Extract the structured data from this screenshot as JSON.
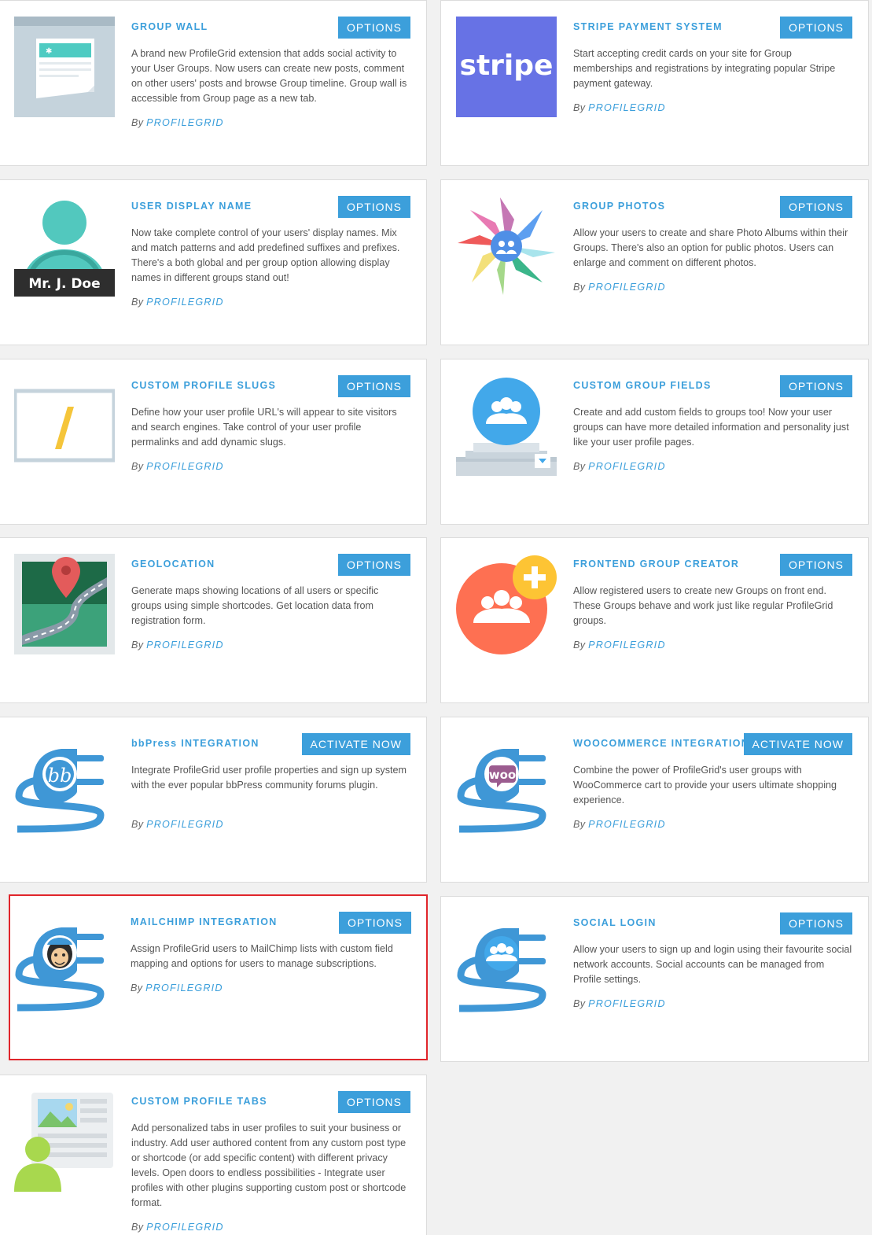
{
  "by_prefix": "By",
  "author": "PROFILEGRID",
  "colors": {
    "accent": "#3c9fdb",
    "highlight_border": "#e0252b"
  },
  "extensions": [
    {
      "title": "GROUP WALL",
      "button": "OPTIONS",
      "icon": "group-wall-icon",
      "desc": "A brand new ProfileGrid extension that adds social activity to your User Groups. Now users can create new posts, comment on other users' posts and browse Group timeline. Group wall is accessible from Group page as a new tab."
    },
    {
      "title": "STRIPE PAYMENT SYSTEM",
      "button": "OPTIONS",
      "icon": "stripe-logo-icon",
      "logo_text": "stripe",
      "desc": "Start accepting credit cards on your site for Group memberships and registrations by integrating popular Stripe payment gateway."
    },
    {
      "title": "USER DISPLAY NAME",
      "button": "OPTIONS",
      "icon": "user-display-name-icon",
      "logo_text": "Mr. J. Doe",
      "desc": "Now take complete control of your users' display names. Mix and match patterns and add predefined suffixes and prefixes. There's a both global and per group option allowing display names in different groups stand out!"
    },
    {
      "title": "GROUP PHOTOS",
      "button": "OPTIONS",
      "icon": "group-photos-icon",
      "desc": "Allow your users to create and share Photo Albums within their Groups. There's also an option for public photos. Users can enlarge and comment on different photos."
    },
    {
      "title": "CUSTOM PROFILE SLUGS",
      "button": "OPTIONS",
      "icon": "profile-slugs-icon",
      "desc": "Define how your user profile URL's will appear to site visitors and search engines. Take control of your user profile permalinks and add dynamic slugs."
    },
    {
      "title": "CUSTOM GROUP FIELDS",
      "button": "OPTIONS",
      "icon": "group-fields-icon",
      "desc": "Create and add custom fields to groups too! Now your user groups can have more detailed information and personality just like your user profile pages."
    },
    {
      "title": "GEOLOCATION",
      "button": "OPTIONS",
      "icon": "geolocation-map-icon",
      "desc": "Generate maps showing locations of all users or specific groups using simple shortcodes. Get location data from registration form."
    },
    {
      "title": "FRONTEND GROUP CREATOR",
      "button": "OPTIONS",
      "icon": "group-creator-icon",
      "desc": "Allow registered users to create new Groups on front end. These Groups behave and work just like regular ProfileGrid groups."
    },
    {
      "title": "bbPress INTEGRATION",
      "button": "ACTIVATE NOW",
      "icon": "bbpress-plug-icon",
      "desc": "Integrate ProfileGrid user profile properties and sign up system with the ever popular bbPress community forums plugin."
    },
    {
      "title": "WOOCOMMERCE INTEGRATION",
      "button": "ACTIVATE NOW",
      "icon": "woocommerce-plug-icon",
      "logo_text": "woo",
      "desc": "Combine the power of ProfileGrid's user groups with WooCommerce cart to provide your users ultimate shopping experience."
    },
    {
      "title": "MAILCHIMP INTEGRATION",
      "button": "OPTIONS",
      "icon": "mailchimp-plug-icon",
      "desc": "Assign ProfileGrid users to MailChimp lists with custom field mapping and options for users to manage subscriptions."
    },
    {
      "title": "SOCIAL LOGIN",
      "button": "OPTIONS",
      "icon": "social-login-plug-icon",
      "desc": "Allow your users to sign up and login using their favourite social network accounts. Social accounts can be managed from Profile settings."
    },
    {
      "title": "CUSTOM PROFILE TABS",
      "button": "OPTIONS",
      "icon": "profile-tabs-icon",
      "desc": "Add personalized tabs in user profiles to suit your business or industry. Add user authored content from any custom post type or shortcode (or add specific content) with different privacy levels. Open doors to endless possibilities - Integrate user profiles with other plugins supporting custom post or shortcode format."
    }
  ]
}
